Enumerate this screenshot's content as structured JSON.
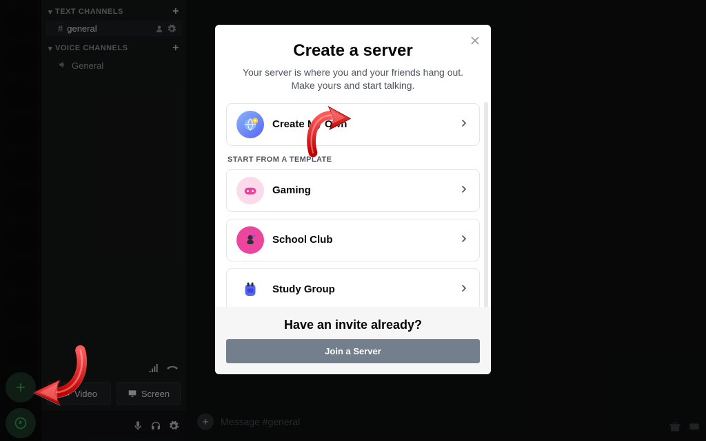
{
  "sidebar": {
    "text_cat": "TEXT CHANNELS",
    "voice_cat": "VOICE CHANNELS",
    "text_channel": "general",
    "voice_channel": "General",
    "video_btn": "Video",
    "screen_btn": "Screen"
  },
  "composer": {
    "placeholder": "Message #general"
  },
  "modal": {
    "title": "Create a server",
    "subtitle": "Your server is where you and your friends hang out. Make yours and start talking.",
    "create_own": "Create My Own",
    "template_label": "START FROM A TEMPLATE",
    "templates": [
      {
        "label": "Gaming"
      },
      {
        "label": "School Club"
      },
      {
        "label": "Study Group"
      }
    ],
    "invite_q": "Have an invite already?",
    "join_label": "Join a Server"
  }
}
